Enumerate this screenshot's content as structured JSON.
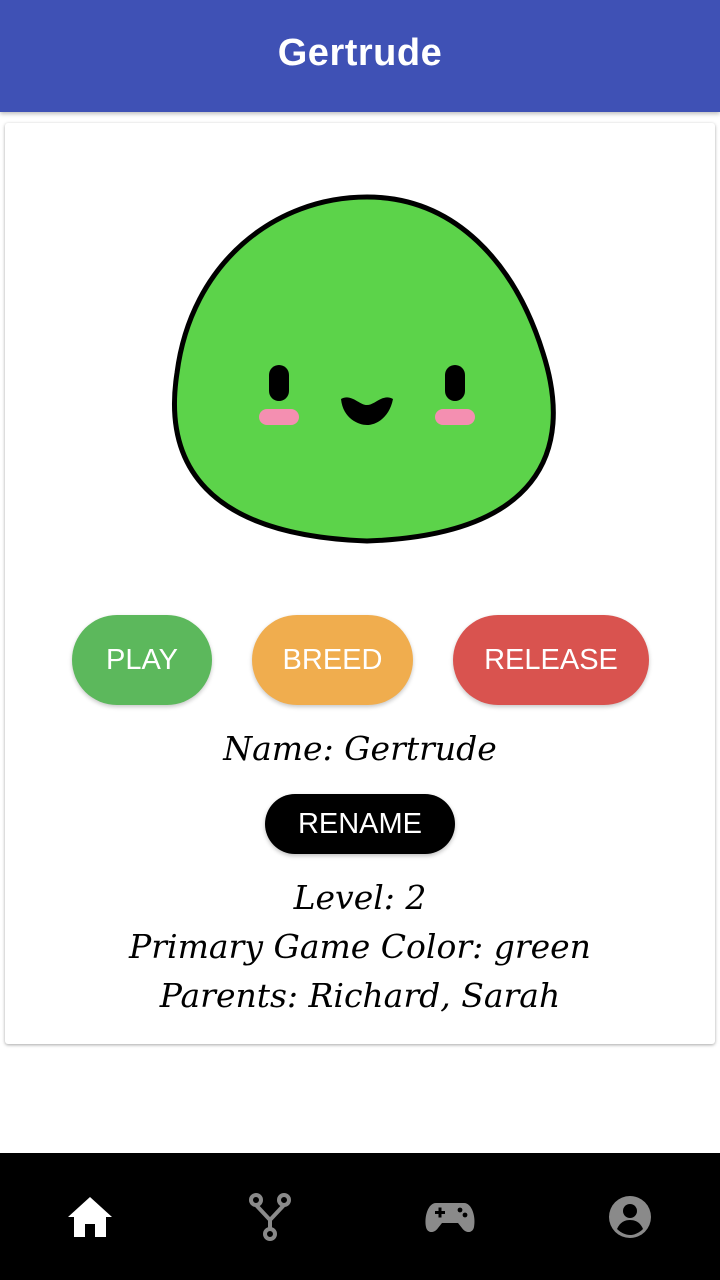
{
  "app_bar": {
    "title": "Gertrude",
    "color": "#3f51b5"
  },
  "creature": {
    "body_color": "#5cd34a",
    "outline_color": "#000000",
    "blush_color": "#f48fb1",
    "face": "smiling",
    "icon": "slime-creature-icon"
  },
  "actions": {
    "play_label": "PLAY",
    "breed_label": "BREED",
    "release_label": "RELEASE",
    "play_color": "#5cb85c",
    "breed_color": "#f0ad4e",
    "release_color": "#d9534f"
  },
  "details": {
    "name_text": "Name: Gertrude",
    "rename_label": "RENAME",
    "level_text": "Level: 2",
    "primary_color_text": "Primary Game Color: green",
    "parents_text": "Parents: Richard, Sarah"
  },
  "bottom_nav": {
    "items": [
      {
        "icon": "home-icon",
        "active": true
      },
      {
        "icon": "fork-icon",
        "active": false
      },
      {
        "icon": "gamepad-icon",
        "active": false
      },
      {
        "icon": "account-icon",
        "active": false
      }
    ],
    "active_color": "#ffffff",
    "inactive_color": "#8a8a8a"
  }
}
